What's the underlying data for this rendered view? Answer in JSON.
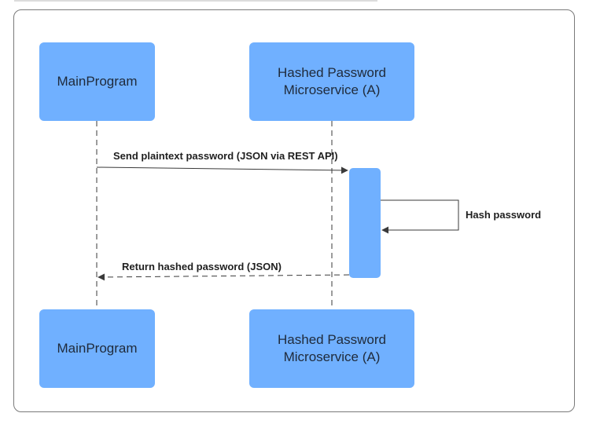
{
  "participants": [
    {
      "id": "main",
      "label": "MainProgram"
    },
    {
      "id": "hash",
      "label": "Hashed Password\nMicroservice (A)"
    }
  ],
  "messages": [
    {
      "from": "main",
      "to": "hash",
      "label": "Send plaintext password (JSON via REST API)",
      "style": "solid"
    },
    {
      "from": "hash",
      "to": "hash",
      "label": "Hash password",
      "style": "solid"
    },
    {
      "from": "hash",
      "to": "main",
      "label": "Return hashed password (JSON)",
      "style": "dashed"
    }
  ],
  "colors": {
    "box_fill": "#70b0ff",
    "line": "#3a3a3a",
    "frame_border": "#7a7a7a"
  }
}
